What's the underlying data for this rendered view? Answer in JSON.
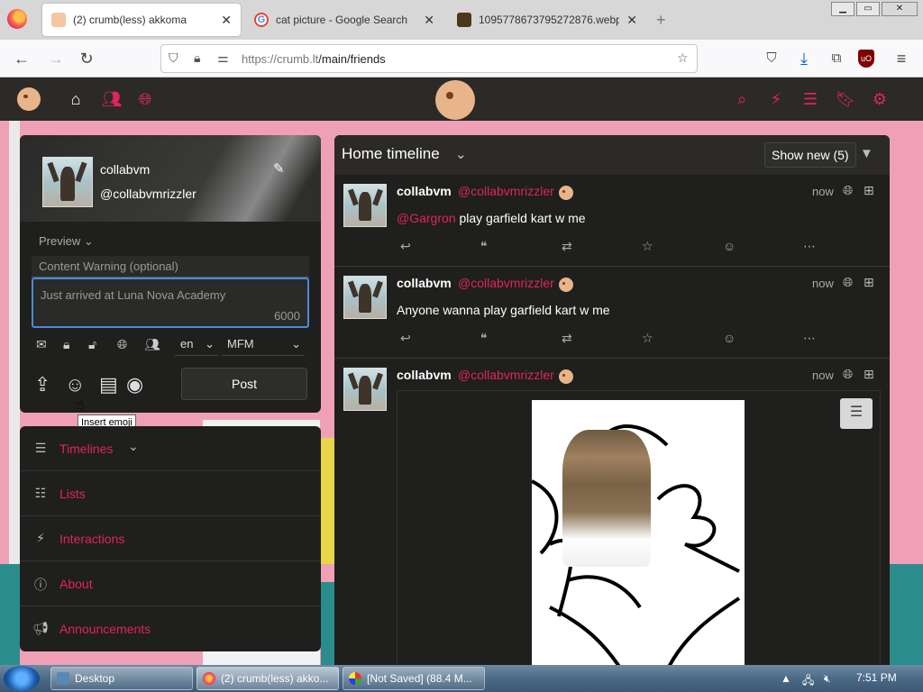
{
  "browser": {
    "tabs": [
      {
        "title": "(2) crumb(less) akkoma",
        "active": true
      },
      {
        "title": "cat picture - Google Search",
        "active": false
      },
      {
        "title": "1095778673795272876.webp (W",
        "active": false
      }
    ],
    "url_host": "https://crumb.lt",
    "url_path": "/main/friends"
  },
  "colors": {
    "accent": "#e0245e",
    "panel": "#1f1f1d",
    "header": "#2b2a27"
  },
  "topnav": {
    "left_icons": [
      "home-icon",
      "users-icon",
      "globe-icon"
    ],
    "right_icons": [
      "search-icon",
      "bolt-icon",
      "list-icon",
      "bookmark-icon",
      "gear-icon"
    ]
  },
  "user": {
    "name": "collabvm",
    "handle": "@collabvmrizzler"
  },
  "composer": {
    "preview_label": "Preview",
    "cw_placeholder": "Content Warning (optional)",
    "placeholder": "Just arrived at Luna Nova Academy",
    "char_count": "6000",
    "language": "en",
    "format": "MFM",
    "post_label": "Post",
    "tooltip": "Insert emoji"
  },
  "nav": [
    {
      "label": "Timelines",
      "icon": "bars-icon"
    },
    {
      "label": "Lists",
      "icon": "list-icon"
    },
    {
      "label": "Interactions",
      "icon": "bolt-icon"
    },
    {
      "label": "About",
      "icon": "info-icon"
    },
    {
      "label": "Announcements",
      "icon": "megaphone-icon"
    }
  ],
  "timeline": {
    "title": "Home timeline",
    "show_new": "Show new (5)",
    "statuses": [
      {
        "name": "collabvm",
        "handle": "@collabvmrizzler",
        "time": "now",
        "mention": "@Gargron",
        "text": " play garfield kart w me"
      },
      {
        "name": "collabvm",
        "handle": "@collabvmrizzler",
        "time": "now",
        "mention": "",
        "text": "Anyone wanna play garfield kart w me"
      },
      {
        "name": "collabvm",
        "handle": "@collabvmrizzler",
        "time": "now",
        "mention": "",
        "text": ""
      }
    ]
  },
  "taskbar": {
    "items": [
      "Desktop",
      "(2) crumb(less) akko...",
      "[Not Saved] (88.4 M..."
    ],
    "clock": "7:51 PM"
  }
}
